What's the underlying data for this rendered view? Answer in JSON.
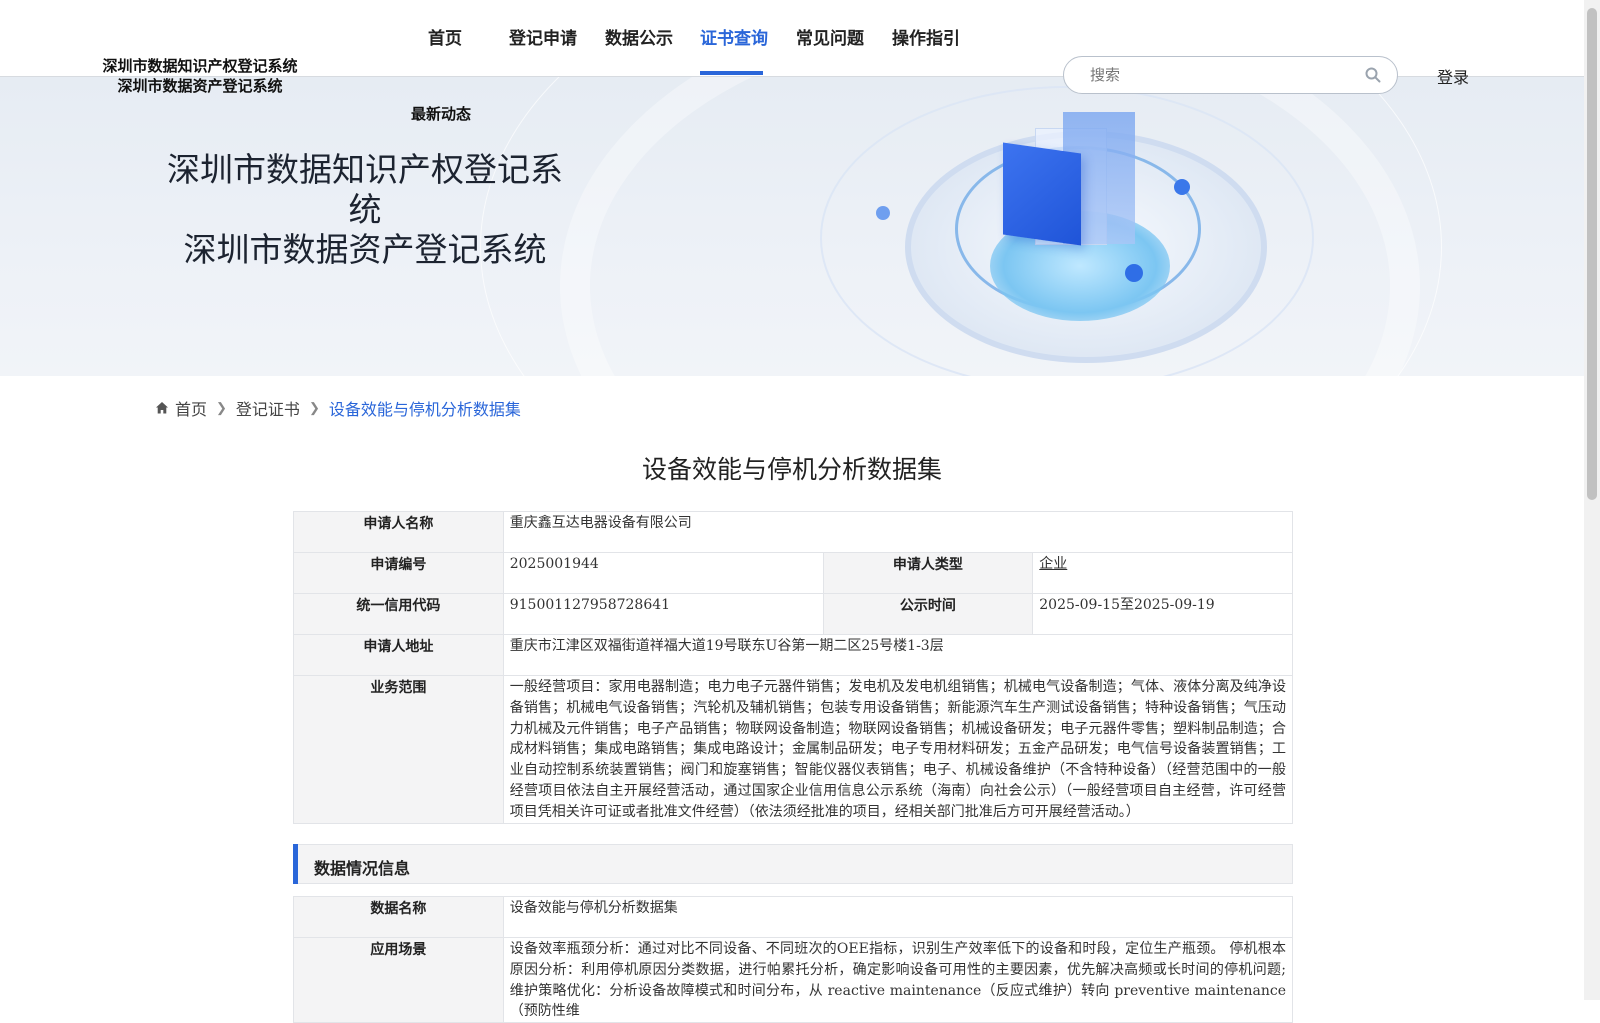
{
  "header": {
    "logo_line1": "深圳市数据知识产权登记系统",
    "logo_line2": "深圳市数据资产登记系统",
    "nav": [
      "首页",
      "登记申请",
      "数据公示",
      "证书查询",
      "常见问题",
      "操作指引"
    ],
    "nav_news": "最新动态",
    "active_nav": "证书查询",
    "search_placeholder": "搜索",
    "login": "登录"
  },
  "banner": {
    "title_line1": "深圳市数据知识产权登记系统",
    "title_line2": "深圳市数据资产登记系统"
  },
  "breadcrumb": {
    "home": "首页",
    "level2": "登记证书",
    "current": "设备效能与停机分析数据集"
  },
  "title": "设备效能与停机分析数据集",
  "applicant": {
    "name_label": "申请人名称",
    "name": "重庆鑫互达电器设备有限公司",
    "code_label": "申请编号",
    "code": "2025001944",
    "type_label": "申请人类型",
    "type": "企业",
    "credit_label": "统一信用代码",
    "credit": "915001127958728641",
    "notice_label": "公示时间",
    "notice": "2025-09-15至2025-09-19",
    "address_label": "申请人地址",
    "address": "重庆市江津区双福街道祥福大道19号联东U谷第一期二区25号楼1-3层",
    "scope_label": "业务范围",
    "scope": "一般经营项目：家用电器制造；电力电子元器件销售；发电机及发电机组销售；机械电气设备制造；气体、液体分离及纯净设备销售；机械电气设备销售；汽轮机及辅机销售；包装专用设备销售；新能源汽车生产测试设备销售；特种设备销售；气压动力机械及元件销售；电子产品销售；物联网设备制造；物联网设备销售；机械设备研发；电子元器件零售；塑料制品制造；合成材料销售；集成电路销售；集成电路设计；金属制品研发；电子专用材料研发；五金产品研发；电气信号设备装置销售；工业自动控制系统装置销售；阀门和旋塞销售；智能仪器仪表销售；电子、机械设备维护（不含特种设备）（经营范围中的一般经营项目依法自主开展经营活动，通过国家企业信用信息公示系统（海南）向社会公示）（一般经营项目自主经营，许可经营项目凭相关许可证或者批准文件经营）（依法须经批准的项目，经相关部门批准后方可开展经营活动。）"
  },
  "data_section": {
    "heading": "数据情况信息",
    "name_label": "数据名称",
    "name": "设备效能与停机分析数据集",
    "scene_label": "应用场景",
    "scene": "设备效率瓶颈分析：通过对比不同设备、不同班次的OEE指标，识别生产效率低下的设备和时段，定位生产瓶颈。 停机根本原因分析：利用停机原因分类数据，进行帕累托分析，确定影响设备可用性的主要因素，优先解决高频或长时间的停机问题; 维护策略优化：分析设备故障模式和时间分布，从 reactive maintenance（反应式维护）转向 preventive maintenance（预防性维"
  },
  "colors": {
    "accent": "#2a66d9",
    "key_cell_bg": "#f4f4f5"
  }
}
